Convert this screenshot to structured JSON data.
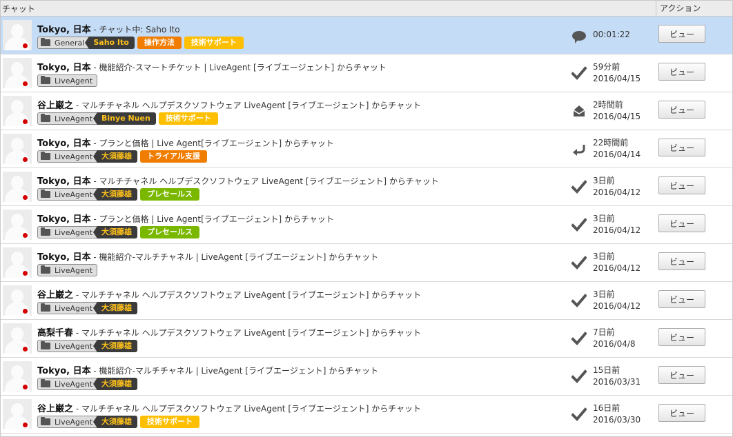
{
  "header": {
    "chat_col": "チャット",
    "action_col": "アクション"
  },
  "view_label": "ビュー",
  "colors": {
    "selected_row": "#c5dcf6",
    "agent_bg": "#3b3b3b",
    "agent_text": "#ffc21a",
    "label_orange": "#f07d00",
    "label_yellow": "#fdbf00",
    "label_green": "#7ab800"
  },
  "rows": [
    {
      "name": "Tokyo, 日本",
      "subject": " - チャット中: Saho Ito",
      "department": "General",
      "agent": "Saho Ito",
      "labels": [
        {
          "text": "操作方法",
          "color": "#f07d00"
        },
        {
          "text": "技術サポート",
          "color": "#fdbf00"
        }
      ],
      "status_icon": "chat-bubble-icon",
      "time": "00:01:22",
      "date": "",
      "selected": true
    },
    {
      "name": "Tokyo, 日本",
      "subject": " - 機能紹介-スマートチケット | LiveAgent [ライブエージェント] からチャット",
      "department": "LiveAgent",
      "agent": "",
      "labels": [],
      "status_icon": "checkmark-icon",
      "time": "59分前",
      "date": "2016/04/15"
    },
    {
      "name": "谷上巌之",
      "subject": " - マルチチャネル ヘルプデスクソフトウェア LiveAgent [ライブエージェント] からチャット",
      "department": "LiveAgent",
      "agent": "Binye Nuen",
      "labels": [
        {
          "text": "技術サポート",
          "color": "#fdbf00"
        }
      ],
      "status_icon": "envelope-open-icon",
      "time": "2時間前",
      "date": "2016/04/15"
    },
    {
      "name": "Tokyo, 日本",
      "subject": " - プランと価格 | Live Agent[ライブエージェント] からチャット",
      "department": "LiveAgent",
      "agent": "大須藤雄",
      "labels": [
        {
          "text": "トライアル支援",
          "color": "#f07d00"
        }
      ],
      "status_icon": "reply-arrow-icon",
      "time": "22時間前",
      "date": "2016/04/14"
    },
    {
      "name": "Tokyo, 日本",
      "subject": " - マルチチャネル ヘルプデスクソフトウェア LiveAgent [ライブエージェント] からチャット",
      "department": "LiveAgent",
      "agent": "大須藤雄",
      "labels": [
        {
          "text": "プレセールス",
          "color": "#7ab800"
        }
      ],
      "status_icon": "checkmark-icon",
      "time": "3日前",
      "date": "2016/04/12"
    },
    {
      "name": "Tokyo, 日本",
      "subject": " - プランと価格 | Live Agent[ライブエージェント] からチャット",
      "department": "LiveAgent",
      "agent": "大須藤雄",
      "labels": [
        {
          "text": "プレセールス",
          "color": "#7ab800"
        }
      ],
      "status_icon": "checkmark-icon",
      "time": "3日前",
      "date": "2016/04/12"
    },
    {
      "name": "Tokyo, 日本",
      "subject": " - 機能紹介-マルチチャネル | LiveAgent [ライブエージェント] からチャット",
      "department": "LiveAgent",
      "agent": "",
      "labels": [],
      "status_icon": "checkmark-icon",
      "time": "3日前",
      "date": "2016/04/12"
    },
    {
      "name": "谷上巌之",
      "subject": " - マルチチャネル ヘルプデスクソフトウェア LiveAgent [ライブエージェント] からチャット",
      "department": "LiveAgent",
      "agent": "大須藤雄",
      "labels": [],
      "status_icon": "checkmark-icon",
      "time": "3日前",
      "date": "2016/04/12"
    },
    {
      "name": "高梨千春",
      "subject": " - マルチチャネル ヘルプデスクソフトウェア LiveAgent [ライブエージェント] からチャット",
      "department": "LiveAgent",
      "agent": "大須藤雄",
      "labels": [],
      "status_icon": "checkmark-icon",
      "time": "7日前",
      "date": "2016/04/8"
    },
    {
      "name": "Tokyo, 日本",
      "subject": " - 機能紹介-マルチチャネル | LiveAgent [ライブエージェント] からチャット",
      "department": "LiveAgent",
      "agent": "大須藤雄",
      "labels": [],
      "status_icon": "checkmark-icon",
      "time": "15日前",
      "date": "2016/03/31"
    },
    {
      "name": "谷上巌之",
      "subject": " - マルチチャネル ヘルプデスクソフトウェア LiveAgent [ライブエージェント] からチャット",
      "department": "LiveAgent",
      "agent": "大須藤雄",
      "labels": [
        {
          "text": "技術サポート",
          "color": "#fdbf00"
        }
      ],
      "status_icon": "checkmark-icon",
      "time": "16日前",
      "date": "2016/03/30"
    }
  ]
}
